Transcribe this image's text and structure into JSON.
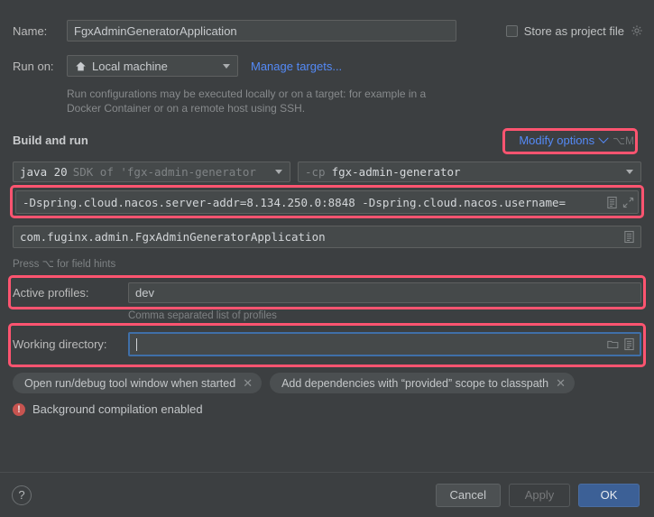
{
  "colors": {
    "background": "#3c3f41",
    "field_bg": "#45494a",
    "link": "#548af7",
    "accent_ok": "#3c6096",
    "annotation": "#ff5470",
    "warning": "#c75450",
    "focus_ring": "#3f6fa8"
  },
  "name_row": {
    "label": "Name:",
    "value": "FgxAdminGeneratorApplication",
    "placeholder": "Name"
  },
  "store_as_project_file": {
    "label": "Store as project file",
    "checked": false,
    "gear_icon": "gear-icon"
  },
  "run_on": {
    "label": "Run on:",
    "selected": "Local machine",
    "icon": "home-icon",
    "manage_targets_link": "Manage targets..."
  },
  "description": "Run configurations may be executed locally or on a target: for example in a Docker Container or on a remote host using SSH.",
  "build_and_run": {
    "header": "Build and run",
    "modify_options_label": "Modify options",
    "modify_options_shortcut": "⌥M",
    "chevron_icon": "chevron-down-icon",
    "sdk": {
      "main": "java 20",
      "sub": "SDK of 'fgx-admin-generator",
      "caret_icon": "caret-down-icon"
    },
    "classpath": {
      "flag": "-cp",
      "value": "fgx-admin-generator",
      "caret_icon": "caret-down-icon"
    },
    "vm_options": {
      "value": "-Dspring.cloud.nacos.server-addr=8.134.250.0:8848 -Dspring.cloud.nacos.username=",
      "list_icon": "list-icon",
      "expand_icon": "expand-icon"
    },
    "main_class": {
      "value": "com.fuginx.admin.FgxAdminGeneratorApplication",
      "list_icon": "list-icon"
    },
    "field_hints": "Press ⌥ for field hints"
  },
  "active_profiles": {
    "label": "Active profiles:",
    "value": "dev",
    "hint": "Comma separated list of profiles"
  },
  "working_directory": {
    "label": "Working directory:",
    "value": "",
    "folder_icon": "folder-icon",
    "list_icon": "list-icon",
    "focused": true
  },
  "chips": [
    {
      "label": "Open run/debug tool window when started",
      "close_icon": "close-icon"
    },
    {
      "label": "Add dependencies with “provided” scope to classpath",
      "close_icon": "close-icon"
    }
  ],
  "warning": {
    "icon": "error-icon",
    "glyph": "!",
    "text": "Background compilation enabled"
  },
  "bottom_bar": {
    "help_label": "?",
    "cancel_label": "Cancel",
    "apply_label": "Apply",
    "ok_label": "OK"
  }
}
